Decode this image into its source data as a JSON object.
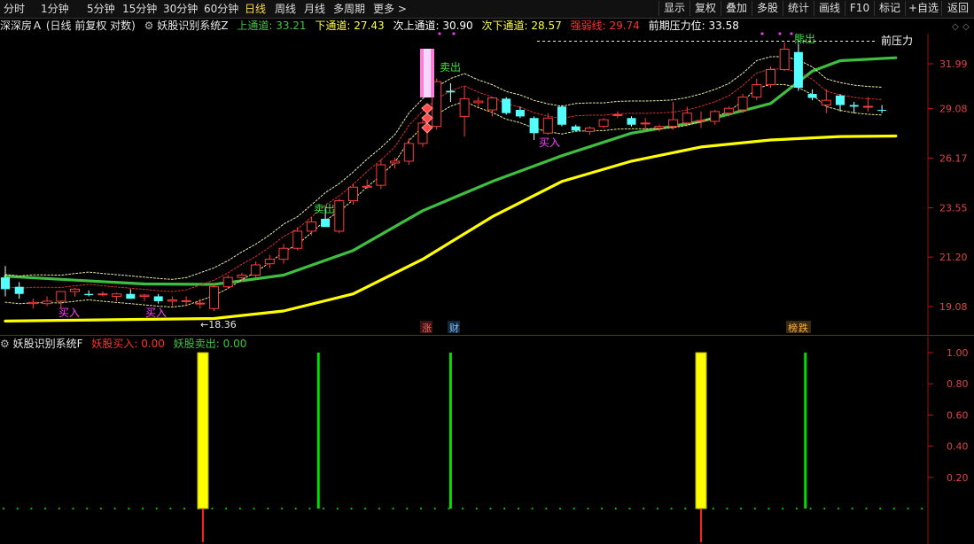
{
  "toolbar": {
    "periods": [
      "分时",
      "1分钟",
      "5分钟",
      "15分钟",
      "30分钟",
      "60分钟",
      "日线",
      "周线",
      "月线",
      "多周期",
      "更多 >"
    ],
    "active_period": "日线",
    "right_buttons": [
      "显示",
      "复权",
      "叠加",
      "多股",
      "统计",
      "画线",
      "F10",
      "标记",
      "+自选",
      "返回"
    ]
  },
  "main_info": {
    "stock_name": "深深房Ａ",
    "mode": "(日线 前复权 对数)",
    "indicator_name": "妖股识别系统Z",
    "items": [
      {
        "label": "上通道:",
        "value": "33.21",
        "color": "#3ec53e"
      },
      {
        "label": "下通道:",
        "value": "27.43",
        "color": "#ffff40"
      },
      {
        "label": "次上通道:",
        "value": "30.90",
        "color": "#ffffff"
      },
      {
        "label": "次下通道:",
        "value": "28.57",
        "color": "#ffff40"
      },
      {
        "label": "强弱线:",
        "value": "29.74",
        "color": "#ff3030"
      },
      {
        "label": "前期压力位:",
        "value": "33.58",
        "color": "#ffffff"
      }
    ]
  },
  "price_axis": [
    "31.99",
    "29.08",
    "26.17",
    "23.55",
    "21.20",
    "19.08"
  ],
  "annotations": {
    "sell": "卖出",
    "buy": "买入",
    "low_price": "←18.36",
    "peak_label": "熊出",
    "resistance": "前压力",
    "zhang": "涨",
    "cai": "财",
    "bang": "榜",
    "die": "跌"
  },
  "sub_info": {
    "indicator_name": "妖股识别系统F",
    "items": [
      {
        "label": "妖股买入:",
        "value": "0.00",
        "color": "#ff3030"
      },
      {
        "label": "妖股卖出:",
        "value": "0.00",
        "color": "#3ec53e"
      }
    ]
  },
  "sub_axis": [
    "1.00",
    "0.80",
    "0.60",
    "0.40",
    "0.20"
  ],
  "colors": {
    "up": "#ff3c3c",
    "down": "#54ffff",
    "upper_band": "#3fbf3f",
    "lower_band": "#ffff00",
    "buy_signal": "#ffff00",
    "sell_signal": "#00e000",
    "active_period": "#ffd84a"
  },
  "candles": [
    {
      "o": 20.3,
      "h": 20.8,
      "l": 19.5,
      "c": 19.8
    },
    {
      "o": 19.9,
      "h": 20.1,
      "l": 19.4,
      "c": 19.6
    },
    {
      "o": 19.2,
      "h": 19.4,
      "l": 19.0,
      "c": 19.25
    },
    {
      "o": 19.2,
      "h": 19.5,
      "l": 19.1,
      "c": 19.3
    },
    {
      "o": 19.3,
      "h": 19.7,
      "l": 19.0,
      "c": 19.7
    },
    {
      "o": 19.7,
      "h": 19.85,
      "l": 19.5,
      "c": 19.8
    },
    {
      "o": 19.6,
      "h": 19.75,
      "l": 19.5,
      "c": 19.55
    },
    {
      "o": 19.6,
      "h": 19.7,
      "l": 19.5,
      "c": 19.6
    },
    {
      "o": 19.5,
      "h": 19.65,
      "l": 19.3,
      "c": 19.6
    },
    {
      "o": 19.6,
      "h": 19.8,
      "l": 19.4,
      "c": 19.4
    },
    {
      "o": 19.5,
      "h": 19.6,
      "l": 19.3,
      "c": 19.55
    },
    {
      "o": 19.5,
      "h": 19.6,
      "l": 19.2,
      "c": 19.3
    },
    {
      "o": 19.3,
      "h": 19.5,
      "l": 19.1,
      "c": 19.35
    },
    {
      "o": 19.3,
      "h": 19.5,
      "l": 19.1,
      "c": 19.32
    },
    {
      "o": 19.2,
      "h": 19.4,
      "l": 19.0,
      "c": 19.22
    },
    {
      "o": 19.0,
      "h": 20.0,
      "l": 18.9,
      "c": 19.9
    },
    {
      "o": 19.9,
      "h": 20.4,
      "l": 19.8,
      "c": 20.3
    },
    {
      "o": 20.3,
      "h": 20.5,
      "l": 20.1,
      "c": 20.4
    },
    {
      "o": 20.4,
      "h": 21.0,
      "l": 20.3,
      "c": 20.85
    },
    {
      "o": 20.9,
      "h": 21.3,
      "l": 20.7,
      "c": 21.1
    },
    {
      "o": 21.1,
      "h": 21.8,
      "l": 20.9,
      "c": 21.6
    },
    {
      "o": 21.6,
      "h": 22.6,
      "l": 21.5,
      "c": 22.4
    },
    {
      "o": 22.4,
      "h": 23.1,
      "l": 22.2,
      "c": 22.85
    },
    {
      "o": 23.0,
      "h": 23.6,
      "l": 22.8,
      "c": 22.6
    },
    {
      "o": 22.4,
      "h": 24.0,
      "l": 22.3,
      "c": 23.9
    },
    {
      "o": 23.9,
      "h": 24.8,
      "l": 23.7,
      "c": 24.6
    },
    {
      "o": 24.6,
      "h": 25.0,
      "l": 24.5,
      "c": 24.65
    },
    {
      "o": 24.7,
      "h": 26.1,
      "l": 24.5,
      "c": 25.8
    },
    {
      "o": 25.9,
      "h": 26.2,
      "l": 25.6,
      "c": 26.0
    },
    {
      "o": 26.0,
      "h": 27.3,
      "l": 25.8,
      "c": 27.0
    },
    {
      "o": 27.0,
      "h": 28.4,
      "l": 26.8,
      "c": 28.2
    },
    {
      "o": 28.0,
      "h": 31.0,
      "l": 27.8,
      "c": 30.8
    },
    {
      "o": 30.2,
      "h": 30.7,
      "l": 29.5,
      "c": 30.1
    },
    {
      "o": 28.6,
      "h": 30.5,
      "l": 27.4,
      "c": 29.7
    },
    {
      "o": 29.45,
      "h": 29.8,
      "l": 29.2,
      "c": 29.55
    },
    {
      "o": 29.0,
      "h": 29.8,
      "l": 28.6,
      "c": 29.75
    },
    {
      "o": 29.7,
      "h": 29.8,
      "l": 28.7,
      "c": 28.8
    },
    {
      "o": 29.0,
      "h": 29.2,
      "l": 28.5,
      "c": 28.6
    },
    {
      "o": 28.5,
      "h": 28.6,
      "l": 27.2,
      "c": 27.6
    },
    {
      "o": 27.6,
      "h": 28.8,
      "l": 27.5,
      "c": 28.5
    },
    {
      "o": 29.2,
      "h": 29.3,
      "l": 28.0,
      "c": 28.1
    },
    {
      "o": 28.0,
      "h": 28.1,
      "l": 27.7,
      "c": 27.75
    },
    {
      "o": 27.7,
      "h": 28.0,
      "l": 27.5,
      "c": 27.9
    },
    {
      "o": 28.0,
      "h": 28.5,
      "l": 27.9,
      "c": 28.4
    },
    {
      "o": 28.65,
      "h": 28.9,
      "l": 28.5,
      "c": 28.7
    },
    {
      "o": 28.5,
      "h": 28.6,
      "l": 28.0,
      "c": 28.1
    },
    {
      "o": 28.2,
      "h": 28.5,
      "l": 27.8,
      "c": 28.2
    },
    {
      "o": 27.9,
      "h": 28.1,
      "l": 27.7,
      "c": 28.0
    },
    {
      "o": 28.0,
      "h": 29.5,
      "l": 27.8,
      "c": 28.4
    },
    {
      "o": 28.2,
      "h": 29.2,
      "l": 28.0,
      "c": 28.8
    },
    {
      "o": 28.3,
      "h": 28.9,
      "l": 27.9,
      "c": 28.35
    },
    {
      "o": 28.3,
      "h": 29.0,
      "l": 28.1,
      "c": 28.9
    },
    {
      "o": 28.8,
      "h": 29.2,
      "l": 28.6,
      "c": 29.1
    },
    {
      "o": 29.0,
      "h": 30.0,
      "l": 28.8,
      "c": 29.8
    },
    {
      "o": 29.8,
      "h": 31.0,
      "l": 29.6,
      "c": 30.6
    },
    {
      "o": 30.6,
      "h": 31.8,
      "l": 30.4,
      "c": 31.6
    },
    {
      "o": 31.6,
      "h": 33.5,
      "l": 31.5,
      "c": 33.0
    },
    {
      "o": 32.8,
      "h": 33.4,
      "l": 30.2,
      "c": 30.4
    },
    {
      "o": 30.0,
      "h": 30.3,
      "l": 29.6,
      "c": 29.75
    },
    {
      "o": 29.3,
      "h": 30.3,
      "l": 28.8,
      "c": 29.6
    },
    {
      "o": 29.9,
      "h": 30.0,
      "l": 28.9,
      "c": 29.3
    },
    {
      "o": 29.3,
      "h": 29.5,
      "l": 28.8,
      "c": 29.2
    },
    {
      "o": 29.2,
      "h": 29.8,
      "l": 28.9,
      "c": 29.22
    },
    {
      "o": 29.0,
      "h": 29.3,
      "l": 28.8,
      "c": 28.95
    }
  ],
  "upper_band": [
    [
      0,
      20.35
    ],
    [
      10,
      20.02
    ],
    [
      15,
      20.0
    ],
    [
      20,
      20.4
    ],
    [
      25,
      21.5
    ],
    [
      30,
      23.4
    ],
    [
      35,
      24.9
    ],
    [
      40,
      26.3
    ],
    [
      45,
      27.6
    ],
    [
      50,
      28.3
    ],
    [
      55,
      29.4
    ],
    [
      58,
      31.5
    ],
    [
      60,
      32.2
    ],
    [
      62,
      32.3
    ],
    [
      64,
      32.4
    ]
  ],
  "lower_band": [
    [
      0,
      18.5
    ],
    [
      15,
      18.6
    ],
    [
      20,
      18.9
    ],
    [
      25,
      19.6
    ],
    [
      30,
      21.1
    ],
    [
      35,
      23.1
    ],
    [
      40,
      24.9
    ],
    [
      45,
      26.0
    ],
    [
      50,
      26.8
    ],
    [
      55,
      27.2
    ],
    [
      60,
      27.4
    ],
    [
      64,
      27.43
    ]
  ],
  "sub_signals": [
    {
      "type": "buy",
      "index": 14.2
    },
    {
      "type": "sell",
      "index": 22.5
    },
    {
      "type": "sell",
      "index": 32.0
    },
    {
      "type": "buy",
      "index": 50.0
    },
    {
      "type": "sell",
      "index": 57.5
    }
  ]
}
